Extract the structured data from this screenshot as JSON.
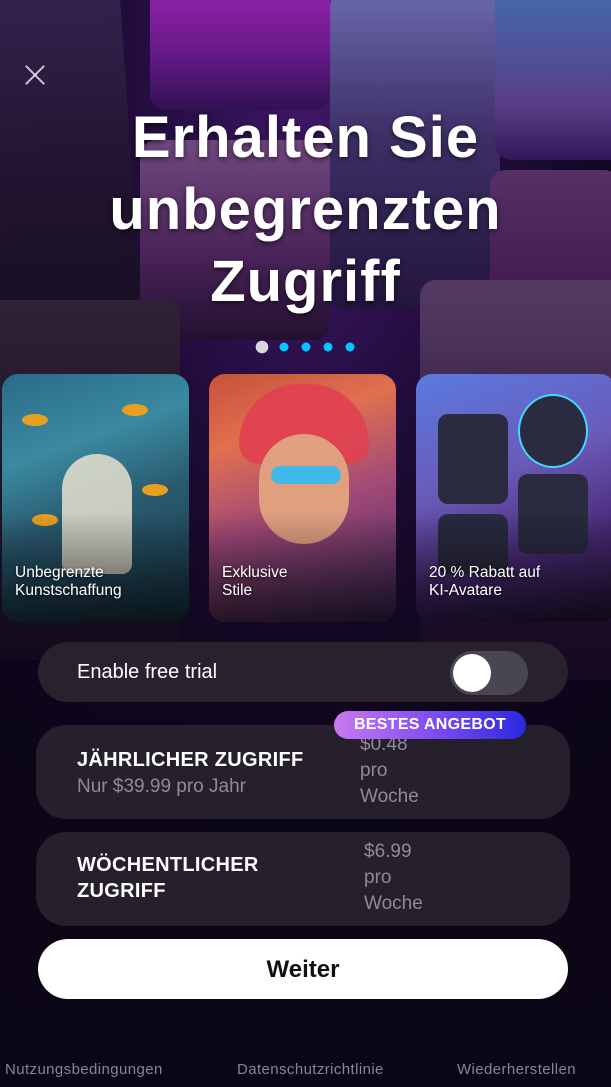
{
  "header": {
    "title": "Erhalten Sie unbegrenzten Zugriff"
  },
  "close_icon": "close-icon",
  "carousel": {
    "dot_count": 5,
    "active_index": 0
  },
  "cards": [
    {
      "label": "Unbegrenzte\nKunstschaffung"
    },
    {
      "label": "Exklusive\nStile"
    },
    {
      "label": "20 % Rabatt auf\nKI-Avatare"
    }
  ],
  "trial": {
    "label": "Enable free trial",
    "enabled": false
  },
  "plans": {
    "badge": "BESTES ANGEBOT",
    "yearly": {
      "name": "JÄHRLICHER ZUGRIFF",
      "subtitle": "Nur $39.99 pro Jahr",
      "price": "$0.48\npro\nWoche"
    },
    "weekly": {
      "name": "WÖCHENTLICHER ZUGRIFF",
      "price": "$6.99\npro\nWoche"
    }
  },
  "cta": {
    "label": "Weiter"
  },
  "footer": {
    "terms": "Nutzungsbedingungen",
    "privacy": "Datenschutzrichtlinie",
    "restore": "Wiederherstellen"
  },
  "colors": {
    "dot_active": "#d8d8dc",
    "dot_inactive": "#00c8ff",
    "badge_gradient_start": "#c879f0",
    "badge_gradient_end": "#2828e0",
    "card_background": "#25202c",
    "cta_background": "#ffffff"
  }
}
